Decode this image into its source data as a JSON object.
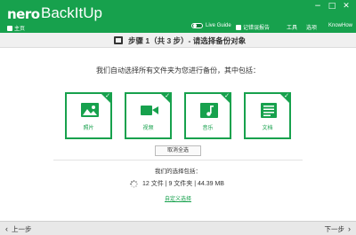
{
  "app": {
    "logo_brand": "nero",
    "logo_product": "BackItUp"
  },
  "window_controls": {
    "minimize": "−",
    "maximize": "□",
    "close": "✕"
  },
  "menu": {
    "home": "主页",
    "live_guide": "Live Guide",
    "feedback": "记错误报告",
    "tools": "工具",
    "options": "选项",
    "knowhow": "KnowHow"
  },
  "step": {
    "text": "步骤 1（共 3 步）- 请选择备份对象"
  },
  "content": {
    "instruction": "我们自动选择所有文件夹为您进行备份，其中包括：",
    "tiles": [
      {
        "label": "照片",
        "icon": "picture-icon"
      },
      {
        "label": "视频",
        "icon": "video-camera-icon"
      },
      {
        "label": "音乐",
        "icon": "music-note-icon"
      },
      {
        "label": "文档",
        "icon": "document-icon"
      }
    ],
    "check_glyph": "✓",
    "deselect_all": "取消全选",
    "selection_title": "我们的选择包括：",
    "selection_summary": "12 文件 | 9 文件夹 | 44.39 MB",
    "custom_selection": "自定义选择"
  },
  "footer": {
    "prev": "上一步",
    "next": "下一步",
    "prev_chevron": "‹",
    "next_chevron": "›"
  },
  "colors": {
    "brand_green": "#17a14d",
    "step_bar": "#f0f0f0",
    "footer": "#e8e8e8"
  }
}
